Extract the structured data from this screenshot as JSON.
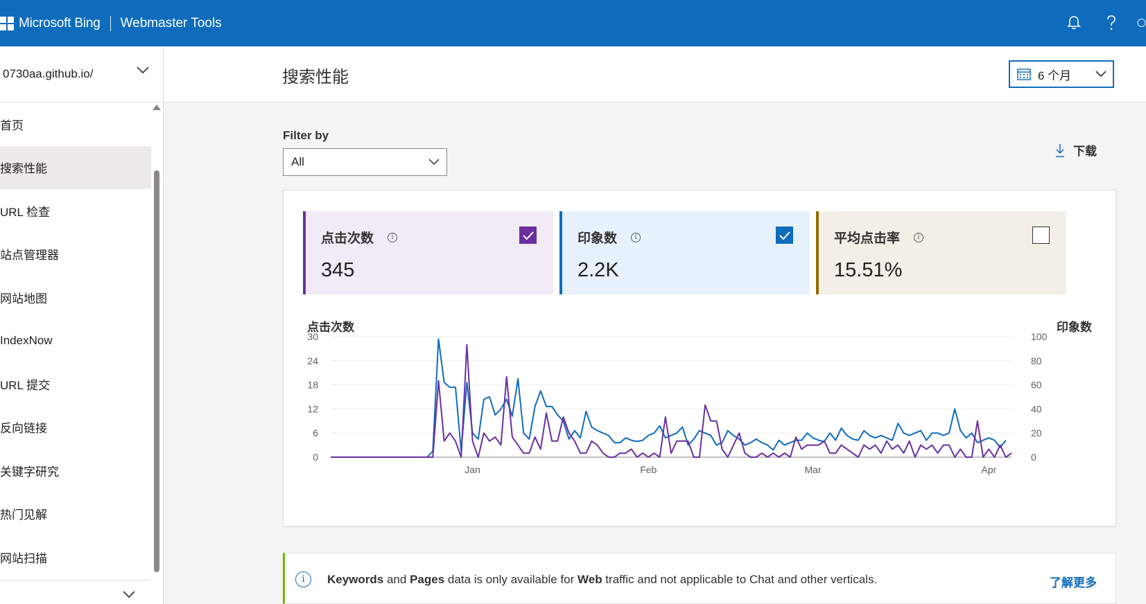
{
  "header": {
    "brand": "Microsoft Bing",
    "product": "Webmaster Tools",
    "icons": [
      "bell-icon",
      "help-icon",
      "account-icon"
    ]
  },
  "sidebar": {
    "site": "0730aa.github.io/",
    "items": [
      {
        "label": "首页",
        "active": false
      },
      {
        "label": "搜索性能",
        "active": true
      },
      {
        "label": "URL 检查",
        "active": false
      },
      {
        "label": "站点管理器",
        "active": false
      },
      {
        "label": "网站地图",
        "active": false
      },
      {
        "label": "IndexNow",
        "active": false
      },
      {
        "label": "URL 提交",
        "active": false
      },
      {
        "label": "反向链接",
        "active": false
      },
      {
        "label": "关键字研究",
        "active": false
      },
      {
        "label": "热门见解",
        "active": false
      },
      {
        "label": "网站扫描",
        "active": false
      }
    ]
  },
  "main": {
    "title": "搜索性能",
    "date_range": "6 个月",
    "filter_label": "Filter by",
    "filter_value": "All",
    "download_label": "下载"
  },
  "metrics": [
    {
      "label": "点击次数",
      "value": "345",
      "checked": true,
      "color": "#6b2fa0",
      "bg": "#f0ebf7"
    },
    {
      "label": "印象数",
      "value": "2.2K",
      "checked": true,
      "color": "#0f6cbd",
      "bg": "#e6f1fb"
    },
    {
      "label": "平均点击率",
      "value": "15.51%",
      "checked": false,
      "color": "#8e6a00",
      "bg": "#f3efe6"
    }
  ],
  "chart_data": {
    "type": "line",
    "left_axis_title": "点击次数",
    "right_axis_title": "印象数",
    "y_left_ticks": [
      0,
      6,
      12,
      18,
      24,
      30
    ],
    "y_right_ticks": [
      0,
      20,
      40,
      60,
      80,
      100
    ],
    "ylim_left": [
      0,
      30
    ],
    "ylim_right": [
      0,
      100
    ],
    "x_ticks": [
      {
        "label": "Jan",
        "index": 25
      },
      {
        "label": "Feb",
        "index": 56
      },
      {
        "label": "Mar",
        "index": 85
      },
      {
        "label": "Apr",
        "index": 116
      }
    ],
    "series": [
      {
        "name": "点击次数",
        "axis": "left",
        "color": "#6b2fa0",
        "values": [
          0,
          0,
          0,
          0,
          0,
          0,
          0,
          0,
          0,
          0,
          0,
          0,
          0,
          0,
          0,
          0,
          0,
          0,
          0,
          19,
          4,
          6,
          4,
          0,
          28,
          4,
          0,
          6,
          4,
          5,
          3,
          20,
          5,
          3,
          1,
          1,
          5,
          2,
          11,
          4,
          4,
          10,
          6,
          4,
          1,
          1,
          4,
          3,
          1,
          0,
          0,
          1,
          1,
          2,
          0,
          1,
          0,
          1,
          0,
          10,
          1,
          4,
          4,
          4,
          0,
          0,
          13,
          9,
          9,
          2,
          0,
          3,
          6,
          1,
          0,
          0,
          1,
          0,
          1,
          0,
          1,
          0,
          5,
          2,
          3,
          3,
          3,
          4,
          1,
          1,
          3,
          2,
          1,
          0,
          3,
          2,
          3,
          1,
          4,
          2,
          3,
          1,
          4,
          0,
          3,
          2,
          3,
          1,
          3,
          3,
          0,
          2,
          0,
          0,
          9,
          0,
          2,
          0,
          3,
          0,
          1
        ]
      },
      {
        "name": "印象数",
        "axis": "right",
        "color": "#0f6cbd",
        "values": [
          0,
          0,
          0,
          0,
          0,
          0,
          0,
          0,
          0,
          0,
          0,
          0,
          0,
          0,
          0,
          0,
          0,
          0,
          5,
          98,
          62,
          58,
          58,
          5,
          62,
          20,
          15,
          48,
          50,
          35,
          40,
          48,
          34,
          65,
          20,
          15,
          42,
          55,
          42,
          42,
          35,
          30,
          15,
          22,
          16,
          38,
          25,
          22,
          20,
          18,
          12,
          12,
          16,
          14,
          13,
          14,
          18,
          20,
          26,
          16,
          18,
          20,
          25,
          10,
          15,
          22,
          20,
          18,
          10,
          12,
          22,
          18,
          15,
          10,
          12,
          15,
          12,
          10,
          6,
          14,
          10,
          12,
          14,
          14,
          20,
          16,
          14,
          13,
          20,
          14,
          24,
          18,
          15,
          14,
          22,
          18,
          16,
          18,
          16,
          14,
          28,
          20,
          18,
          20,
          22,
          14,
          20,
          20,
          18,
          20,
          40,
          22,
          16,
          20,
          12,
          14,
          16,
          14,
          8,
          14
        ]
      }
    ]
  },
  "info_bar": {
    "w1": "Keywords",
    "t1": " and ",
    "w2": "Pages",
    "t2": " data is only available for ",
    "w3": "Web",
    "t3": " traffic and not applicable to Chat and other verticals.",
    "link": "了解更多"
  }
}
